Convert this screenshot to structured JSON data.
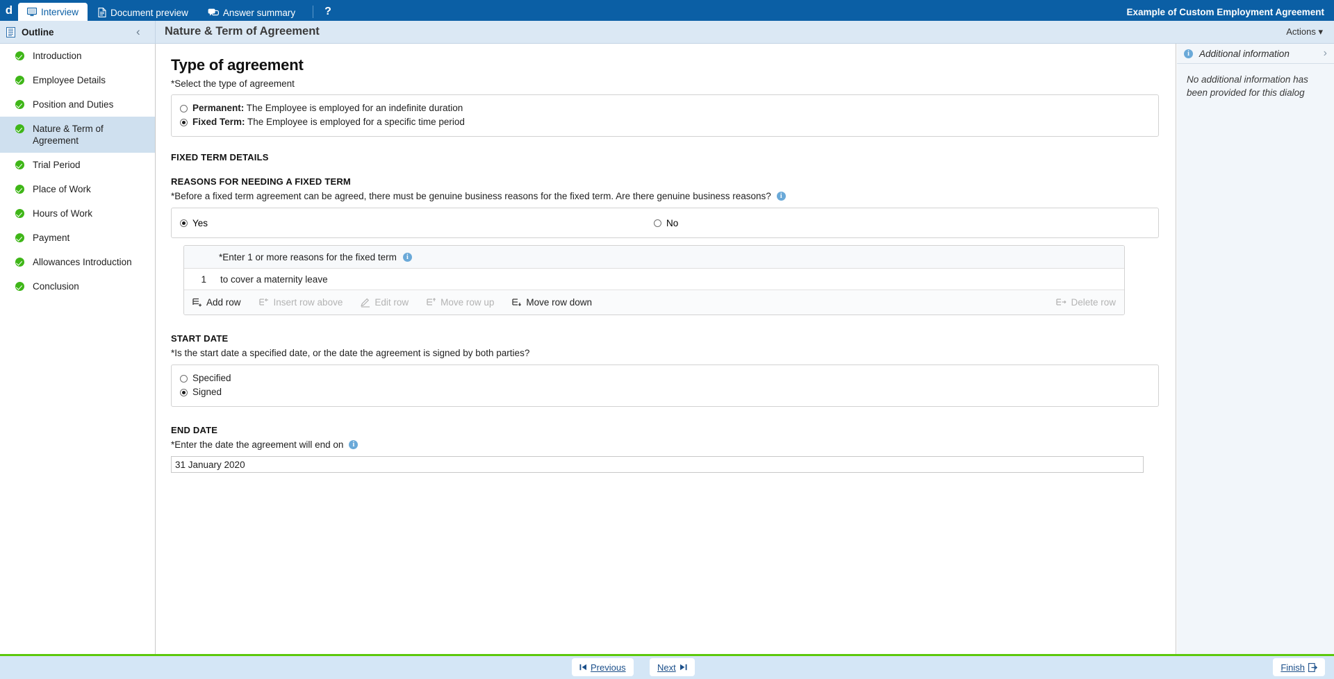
{
  "topbar": {
    "brand": "d",
    "tabs": [
      {
        "label": "Interview",
        "icon": "monitor-icon",
        "active": true
      },
      {
        "label": "Document preview",
        "icon": "document-icon",
        "active": false
      },
      {
        "label": "Answer summary",
        "icon": "comments-icon",
        "active": false
      }
    ],
    "help_label": "?",
    "document_title": "Example of Custom Employment Agreement"
  },
  "subbar": {
    "outline_label": "Outline",
    "outline_icon": "list-icon",
    "collapse_icon": "chevron-left-icon",
    "page_title": "Nature & Term of Agreement",
    "actions_label": "Actions",
    "actions_caret": "▾"
  },
  "sidebar": {
    "items": [
      {
        "label": "Introduction",
        "complete": true,
        "selected": false
      },
      {
        "label": "Employee Details",
        "complete": true,
        "selected": false
      },
      {
        "label": "Position and Duties",
        "complete": true,
        "selected": false
      },
      {
        "label": "Nature & Term of Agreement",
        "complete": true,
        "selected": true
      },
      {
        "label": "Trial Period",
        "complete": true,
        "selected": false
      },
      {
        "label": "Place of Work",
        "complete": true,
        "selected": false
      },
      {
        "label": "Hours of Work",
        "complete": true,
        "selected": false
      },
      {
        "label": "Payment",
        "complete": true,
        "selected": false
      },
      {
        "label": "Allowances Introduction",
        "complete": true,
        "selected": false
      },
      {
        "label": "Conclusion",
        "complete": true,
        "selected": false
      }
    ]
  },
  "main": {
    "section_title": "Type of agreement",
    "type_prompt": "*Select the type of agreement",
    "type_options": [
      {
        "bold": "Permanent:",
        "text": " The Employee is employed for an indefinite duration",
        "checked": false
      },
      {
        "bold": "Fixed Term:",
        "text": " The Employee is employed for a specific time period",
        "checked": true
      }
    ],
    "fixed_term_heading": "FIXED TERM DETAILS",
    "reasons_heading": "REASONS FOR NEEDING A FIXED TERM",
    "reasons_prompt": "*Before a fixed term agreement can be agreed, there must be genuine business reasons for the fixed term. Are there genuine business reasons?",
    "reasons_info_icon": "info-icon",
    "yesno": [
      {
        "label": "Yes",
        "checked": true
      },
      {
        "label": "No",
        "checked": false
      }
    ],
    "table": {
      "column_header": "*Enter 1 or more reasons for the fixed term",
      "header_info_icon": "info-icon",
      "rows": [
        {
          "num": "1",
          "value": "to cover a maternity leave"
        }
      ],
      "toolbar": [
        {
          "label": "Add row",
          "icon": "add-row-icon",
          "disabled": false
        },
        {
          "label": "Insert row above",
          "icon": "insert-row-above-icon",
          "disabled": true
        },
        {
          "label": "Edit row",
          "icon": "edit-row-icon",
          "disabled": true
        },
        {
          "label": "Move row up",
          "icon": "move-row-up-icon",
          "disabled": true
        },
        {
          "label": "Move row down",
          "icon": "move-row-down-icon",
          "disabled": false
        }
      ],
      "delete_label": "Delete row",
      "delete_icon": "delete-row-icon"
    },
    "start_date_heading": "START DATE",
    "start_date_prompt": "*Is the start date a specified date, or the date the agreement is signed by both parties?",
    "start_date_options": [
      {
        "label": "Specified",
        "checked": false
      },
      {
        "label": "Signed",
        "checked": true
      }
    ],
    "end_date_heading": "END DATE",
    "end_date_prompt": "*Enter the date the agreement will end on",
    "end_date_info_icon": "info-icon",
    "end_date_value": "31 January 2020"
  },
  "right_panel": {
    "icon": "info-icon",
    "title": "Additional information",
    "chevron": "chevron-right-icon",
    "body": "No additional information has been provided for this dialog"
  },
  "bottombar": {
    "previous_label": "Previous",
    "previous_icon": "skip-back-icon",
    "next_label": "Next",
    "next_icon": "skip-forward-icon",
    "finish_label": "Finish",
    "finish_icon": "finish-icon"
  },
  "colors": {
    "brand_blue": "#0b5fa5",
    "subbar_blue": "#dbe8f4",
    "selected_item": "#cfe0ef",
    "complete_green": "#3fb618",
    "accent_green_line": "#5cc80c",
    "info_blue": "#6aa9d8",
    "bottom_bar": "#d4e6f6",
    "link_blue": "#1b4f8a"
  }
}
